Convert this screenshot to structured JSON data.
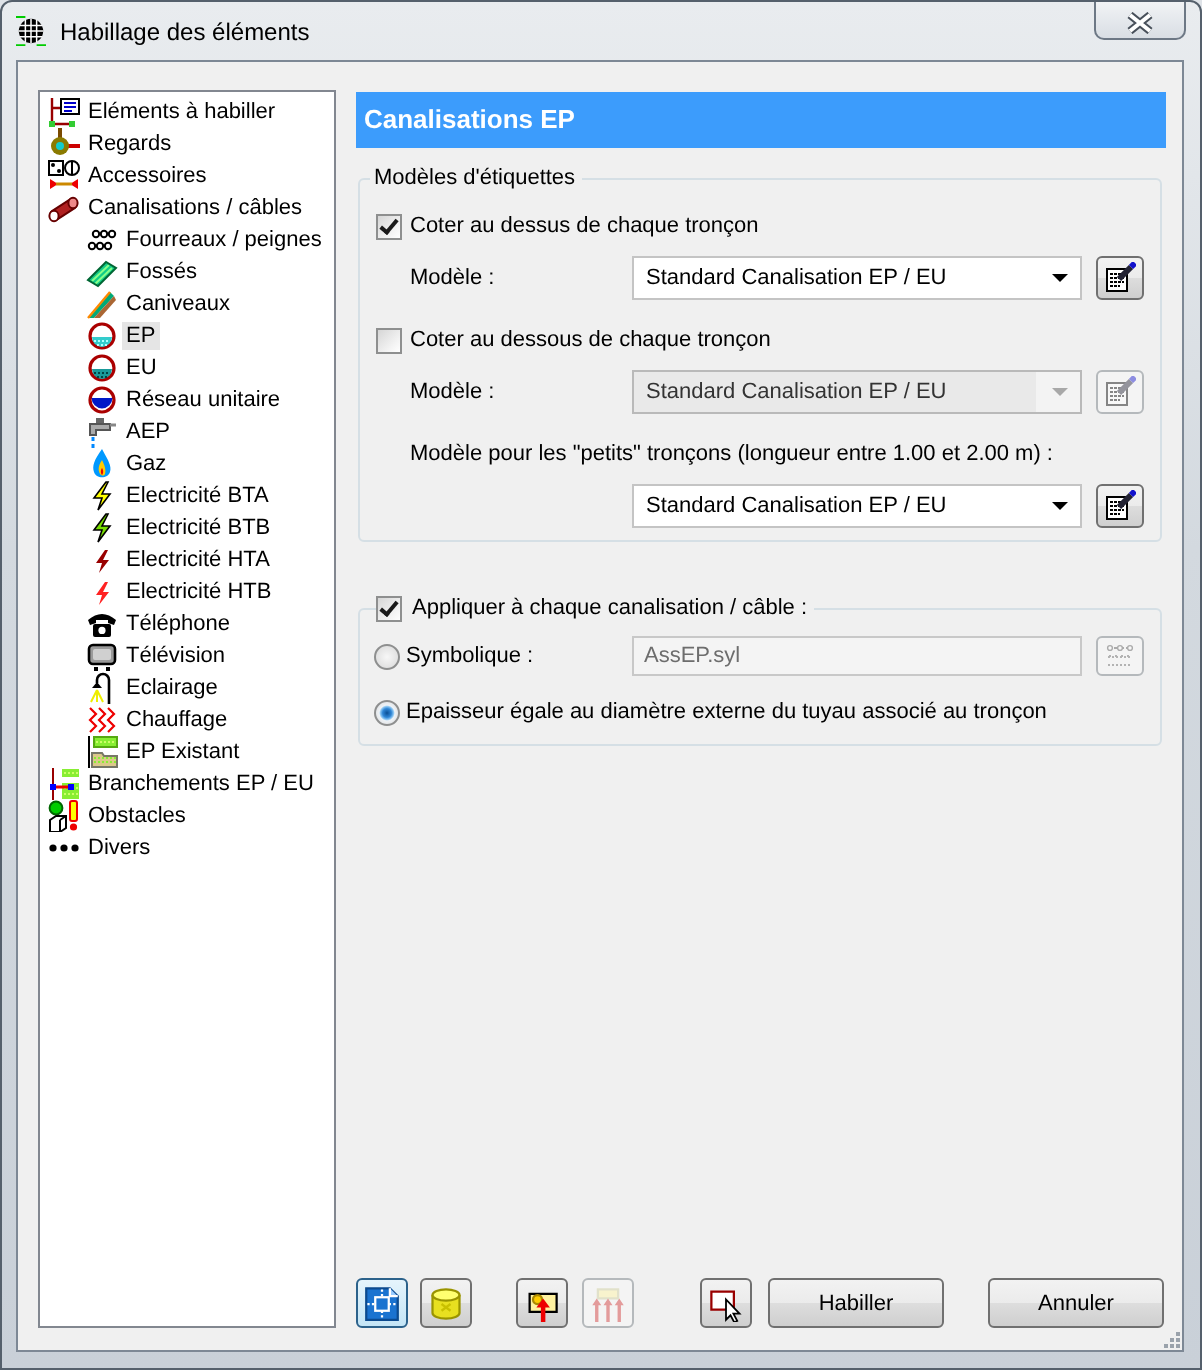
{
  "window": {
    "title": "Habillage des éléments"
  },
  "tree": {
    "items": [
      {
        "label": "Eléments à habiller",
        "selected": false
      },
      {
        "label": "Regards",
        "selected": false
      },
      {
        "label": "Accessoires",
        "selected": false
      },
      {
        "label": "Canalisations / câbles",
        "selected": false,
        "children": [
          {
            "label": "Fourreaux / peignes",
            "selected": false
          },
          {
            "label": "Fossés",
            "selected": false
          },
          {
            "label": "Caniveaux",
            "selected": false
          },
          {
            "label": "EP",
            "selected": true
          },
          {
            "label": "EU",
            "selected": false
          },
          {
            "label": "Réseau unitaire",
            "selected": false
          },
          {
            "label": "AEP",
            "selected": false
          },
          {
            "label": "Gaz",
            "selected": false
          },
          {
            "label": "Electricité BTA",
            "selected": false
          },
          {
            "label": "Electricité BTB",
            "selected": false
          },
          {
            "label": "Electricité HTA",
            "selected": false
          },
          {
            "label": "Electricité HTB",
            "selected": false
          },
          {
            "label": "Téléphone",
            "selected": false
          },
          {
            "label": "Télévision",
            "selected": false
          },
          {
            "label": "Eclairage",
            "selected": false
          },
          {
            "label": "Chauffage",
            "selected": false
          },
          {
            "label": "EP Existant",
            "selected": false
          }
        ]
      },
      {
        "label": "Branchements EP / EU",
        "selected": false
      },
      {
        "label": "Obstacles",
        "selected": false
      },
      {
        "label": "Divers",
        "selected": false
      }
    ]
  },
  "panel": {
    "title": "Canalisations EP",
    "label_templates": {
      "legend": "Modèles d'étiquettes",
      "rows": [
        {
          "kind": "checkbox",
          "label": "Coter au dessus de chaque tronçon",
          "checked": true
        },
        {
          "kind": "select",
          "label": "Modèle :",
          "value": "Standard Canalisation EP / EU",
          "disabled": false
        },
        {
          "kind": "checkbox",
          "label": "Coter au dessous de chaque tronçon",
          "checked": false
        },
        {
          "kind": "select",
          "label": "Modèle :",
          "value": "Standard Canalisation EP / EU",
          "disabled": true
        },
        {
          "kind": "caption",
          "label": "Modèle pour les \"petits\" tronçons (longueur entre 1.00 et 2.00 m) :"
        },
        {
          "kind": "select",
          "value": "Standard Canalisation EP / EU",
          "disabled": false
        }
      ]
    },
    "apply": {
      "label": "Appliquer à chaque canalisation / câble :",
      "checked": true,
      "options": [
        {
          "kind": "field",
          "label": "Symbolique :",
          "selected": false,
          "value": "AssEP.syl",
          "disabled": true
        },
        {
          "kind": "plain",
          "label": "Epaisseur égale au diamètre externe du tuyau associé au tronçon",
          "selected": true
        }
      ]
    }
  },
  "footer": {
    "tool_buttons": [
      {
        "pressed": true,
        "disabled": false
      },
      {
        "pressed": false,
        "disabled": false
      },
      {
        "pressed": false,
        "disabled": false
      },
      {
        "pressed": false,
        "disabled": true
      },
      {
        "pressed": false,
        "disabled": false
      }
    ],
    "buttons": [
      "Habiller",
      "Annuler"
    ]
  }
}
